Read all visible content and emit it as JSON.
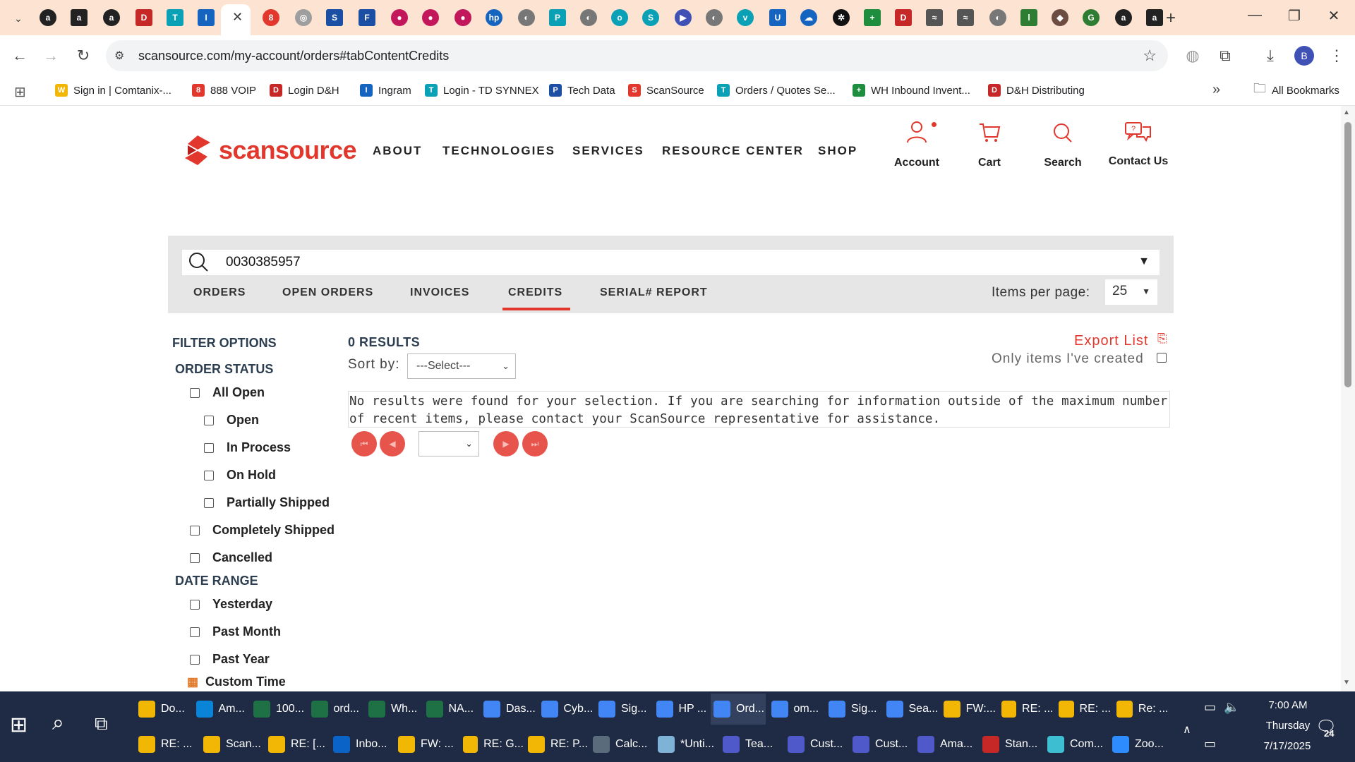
{
  "browser": {
    "url": "scansource.com/my-account/orders#tabContentCredits",
    "bookmarks": [
      {
        "label": "Sign in | Comtanix-...",
        "color": "#f2b705",
        "glyph": "W"
      },
      {
        "label": "888 VOIP",
        "color": "#e2372c",
        "glyph": "8"
      },
      {
        "label": "Login D&H",
        "color": "#c62828",
        "glyph": "D"
      },
      {
        "label": "Ingram",
        "color": "#1565c0",
        "glyph": "I"
      },
      {
        "label": "Login - TD SYNNEX",
        "color": "#0aa0b5",
        "glyph": "T"
      },
      {
        "label": "Tech Data",
        "color": "#1a4fa3",
        "glyph": "P"
      },
      {
        "label": "ScanSource",
        "color": "#e2372c",
        "glyph": "S"
      },
      {
        "label": "Orders / Quotes Se...",
        "color": "#0aa0b5",
        "glyph": "T"
      },
      {
        "label": "WH Inbound Invent...",
        "color": "#1e8e3e",
        "glyph": "+"
      },
      {
        "label": "D&H Distributing",
        "color": "#c62828",
        "glyph": "D"
      }
    ],
    "all_bookmarks_label": "All Bookmarks",
    "profile_initial": "B"
  },
  "site": {
    "logo_text": "scansource",
    "nav": [
      "ABOUT",
      "TECHNOLOGIES",
      "SERVICES",
      "RESOURCE CENTER",
      "SHOP"
    ],
    "utilities": [
      {
        "label": "Account",
        "icon": "user-icon"
      },
      {
        "label": "Cart",
        "icon": "cart-icon"
      },
      {
        "label": "Search",
        "icon": "search-icon"
      },
      {
        "label": "Contact Us",
        "icon": "chat-icon"
      }
    ]
  },
  "search": {
    "value": "0030385957",
    "tabs": [
      "ORDERS",
      "OPEN ORDERS",
      "INVOICES",
      "CREDITS",
      "SERIAL# REPORT"
    ],
    "active_tab": "CREDITS",
    "items_per_page_label": "Items per page:",
    "items_per_page_value": "25"
  },
  "filters": {
    "title": "FILTER OPTIONS",
    "order_status_title": "ORDER STATUS",
    "order_status": [
      "All Open",
      "Open",
      "In Process",
      "On Hold",
      "Partially Shipped",
      "Completely Shipped",
      "Cancelled"
    ],
    "date_range_title": "DATE RANGE",
    "date_range": [
      "Yesterday",
      "Past Month",
      "Past Year"
    ],
    "custom_time_label": "Custom Time"
  },
  "results": {
    "count_label": "0 RESULTS",
    "sort_label": "Sort by:",
    "sort_value": "---Select---",
    "export_label": "Export List",
    "only_mine_label": "Only items I've created",
    "message": "No results were found for your selection. If you are searching for information outside of the maximum number of recent items, please contact your ScanSource representative for assistance."
  },
  "taskbar": {
    "row1": [
      "Do...",
      "Am...",
      "100...",
      "ord...",
      "Wh...",
      "NA...",
      "Das...",
      "Cyb...",
      "Sig...",
      "HP ...",
      "Ord...",
      "om...",
      "Sig...",
      "Sea...",
      "FW:...",
      "RE: ...",
      "RE: ...",
      "Re: ..."
    ],
    "row2": [
      "RE: ...",
      "Scan...",
      "RE: [...",
      "Inbo...",
      "FW: ...",
      "RE: G...",
      "RE: P...",
      "Calc...",
      "*Unti...",
      "Tea...",
      "Cust...",
      "Cust...",
      "Ama...",
      "Stan...",
      "Com...",
      "Zoo..."
    ],
    "time": "7:00 AM",
    "day": "Thursday",
    "date": "7/17/2025",
    "notifications": "24"
  },
  "colors": {
    "brand": "#e2372c",
    "tabstrip": "#fde4d2",
    "taskbar": "#1f2a44"
  }
}
